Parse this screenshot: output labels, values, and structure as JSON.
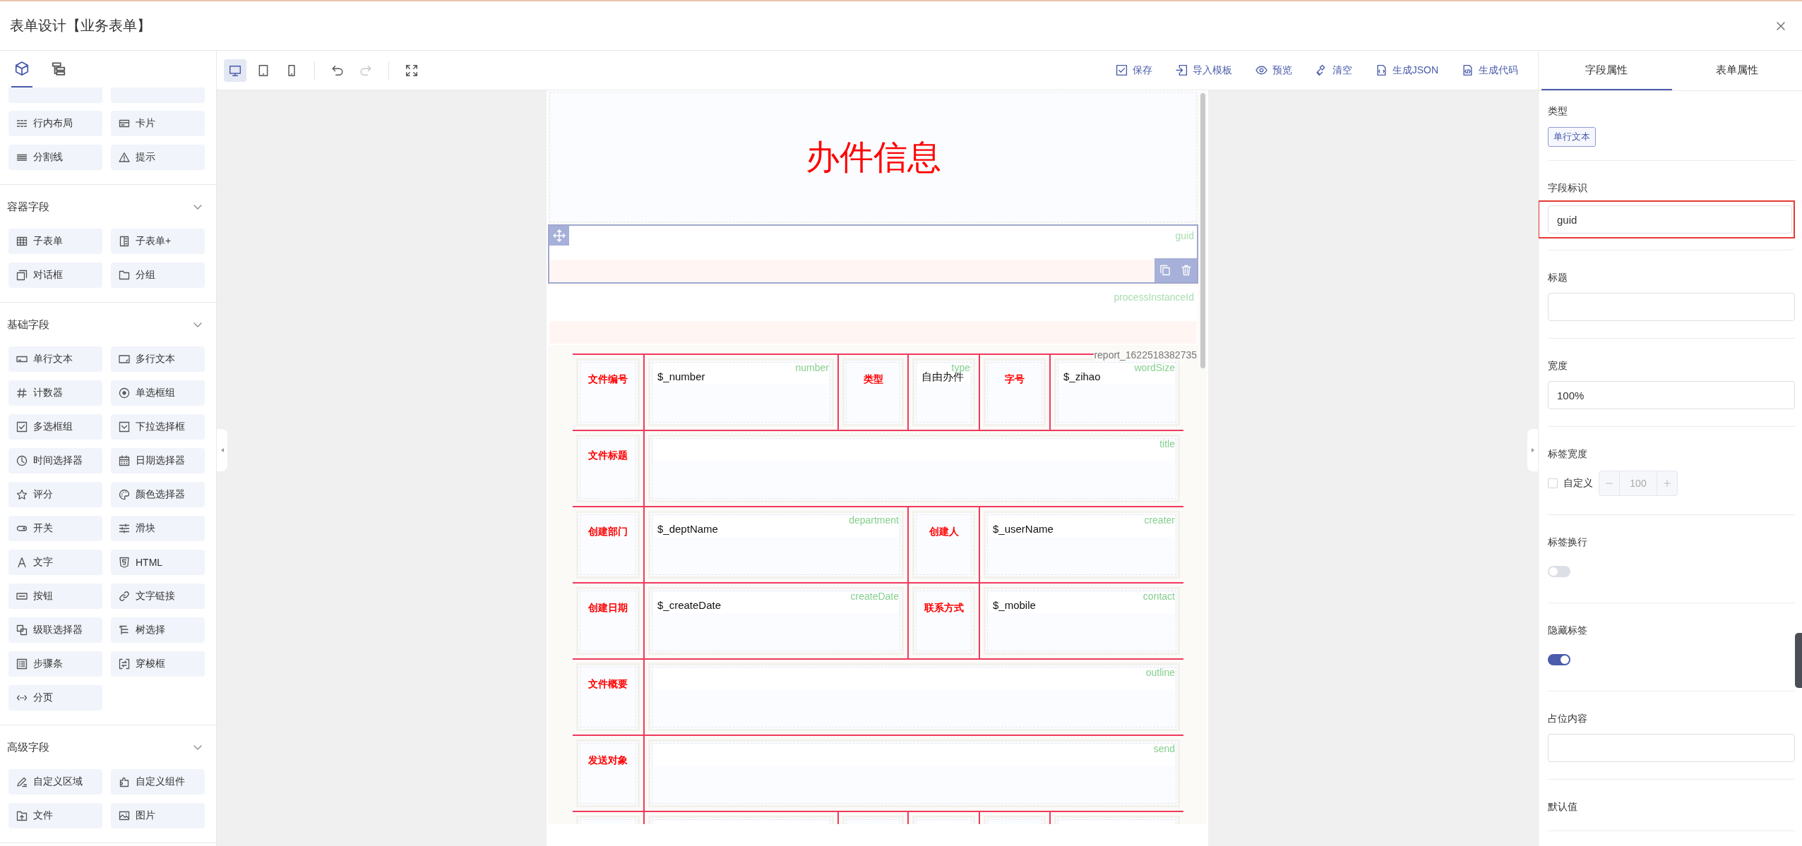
{
  "window": {
    "title": "表单设计【业务表单】"
  },
  "left_panel": {
    "tabs": [
      {
        "kind": "components",
        "selected": true
      },
      {
        "kind": "outline",
        "selected": false
      }
    ],
    "sections": [
      {
        "items": [
          {
            "label": "行内布局",
            "kind": "inline-layout"
          },
          {
            "label": "卡片",
            "kind": "card"
          },
          {
            "label": "分割线",
            "kind": "divider"
          },
          {
            "label": "提示",
            "kind": "alert"
          }
        ]
      },
      {
        "title": "容器字段",
        "expanded": true,
        "items": [
          {
            "label": "子表单",
            "kind": "table"
          },
          {
            "label": "子表单+",
            "kind": "subform-plus"
          },
          {
            "label": "对话框",
            "kind": "dialog"
          },
          {
            "label": "分组",
            "kind": "group"
          }
        ]
      },
      {
        "title": "基础字段",
        "expanded": true,
        "items": [
          {
            "label": "单行文本",
            "kind": "input"
          },
          {
            "label": "多行文本",
            "kind": "textarea"
          },
          {
            "label": "计数器",
            "kind": "number"
          },
          {
            "label": "单选框组",
            "kind": "radio"
          },
          {
            "label": "多选框组",
            "kind": "checkbox"
          },
          {
            "label": "下拉选择框",
            "kind": "select"
          },
          {
            "label": "时间选择器",
            "kind": "time"
          },
          {
            "label": "日期选择器",
            "kind": "date"
          },
          {
            "label": "评分",
            "kind": "rate"
          },
          {
            "label": "颜色选择器",
            "kind": "color"
          },
          {
            "label": "开关",
            "kind": "switch"
          },
          {
            "label": "滑块",
            "kind": "slider"
          },
          {
            "label": "文字",
            "kind": "text"
          },
          {
            "label": "HTML",
            "kind": "html"
          },
          {
            "label": "按钮",
            "kind": "button"
          },
          {
            "label": "文字链接",
            "kind": "link"
          },
          {
            "label": "级联选择器",
            "kind": "cascader"
          },
          {
            "label": "树选择",
            "kind": "tree"
          },
          {
            "label": "步骤条",
            "kind": "steps"
          },
          {
            "label": "穿梭框",
            "kind": "transfer"
          },
          {
            "label": "分页",
            "kind": "pagination"
          }
        ]
      },
      {
        "title": "高级字段",
        "expanded": true,
        "items": [
          {
            "label": "自定义区域",
            "kind": "custom-area"
          },
          {
            "label": "自定义组件",
            "kind": "custom-component"
          },
          {
            "label": "文件",
            "kind": "file"
          },
          {
            "label": "图片",
            "kind": "image"
          }
        ]
      }
    ]
  },
  "toolbar": {
    "devices": [
      {
        "kind": "desktop",
        "selected": true
      },
      {
        "kind": "tablet",
        "selected": false
      },
      {
        "kind": "phone",
        "selected": false
      }
    ],
    "history": [
      {
        "kind": "undo",
        "disabled": false
      },
      {
        "kind": "redo",
        "disabled": true
      }
    ],
    "actions": [
      {
        "label": "保存",
        "kind": "save"
      },
      {
        "label": "导入模板",
        "kind": "import"
      },
      {
        "label": "预览",
        "kind": "preview"
      },
      {
        "label": "清空",
        "kind": "clear"
      },
      {
        "label": "生成JSON",
        "kind": "json"
      },
      {
        "label": "生成代码",
        "kind": "code"
      }
    ]
  },
  "form": {
    "title": "办件信息",
    "widgets": [
      {
        "field": "guid",
        "selected": true
      },
      {
        "field": "processInstanceId",
        "selected": false
      }
    ],
    "report": {
      "name": "report_1622518382735",
      "rows": [
        {
          "cells": [
            {
              "kind": "label",
              "text": "文件编号"
            },
            {
              "kind": "field",
              "value": "$_number",
              "field": "number"
            },
            {
              "kind": "label",
              "text": "类型"
            },
            {
              "kind": "field",
              "value": "自由办件",
              "field": "type"
            },
            {
              "kind": "label",
              "text": "字号"
            },
            {
              "kind": "field",
              "value": "$_zihao",
              "field": "wordSize"
            }
          ]
        },
        {
          "cells": [
            {
              "kind": "label",
              "text": "文件标题"
            },
            {
              "kind": "field",
              "colspan": 5,
              "field": "title"
            }
          ]
        },
        {
          "cells": [
            {
              "kind": "label",
              "text": "创建部门"
            },
            {
              "kind": "field",
              "colspan": 2,
              "value": "$_deptName",
              "field": "department"
            },
            {
              "kind": "label",
              "text": "创建人"
            },
            {
              "kind": "field",
              "colspan": 2,
              "value": "$_userName",
              "field": "creater"
            }
          ]
        },
        {
          "cells": [
            {
              "kind": "label",
              "text": "创建日期"
            },
            {
              "kind": "field",
              "colspan": 2,
              "value": "$_createDate",
              "field": "createDate"
            },
            {
              "kind": "label",
              "text": "联系方式"
            },
            {
              "kind": "field",
              "colspan": 2,
              "value": "$_mobile",
              "field": "contact"
            }
          ]
        },
        {
          "cells": [
            {
              "kind": "label",
              "text": "文件概要"
            },
            {
              "kind": "field",
              "colspan": 5,
              "field": "outline"
            }
          ]
        },
        {
          "cells": [
            {
              "kind": "label",
              "text": "发送对象"
            },
            {
              "kind": "field",
              "colspan": 5,
              "field": "send"
            }
          ]
        },
        {
          "cells": [
            {
              "kind": "label"
            },
            {
              "kind": "field"
            },
            {
              "kind": "label"
            },
            {
              "kind": "field"
            },
            {
              "kind": "label"
            },
            {
              "kind": "field"
            }
          ]
        }
      ]
    }
  },
  "properties": {
    "tabs": [
      {
        "label": "字段属性",
        "selected": true
      },
      {
        "label": "表单属性",
        "selected": false
      }
    ],
    "items": [
      {
        "label": "类型",
        "kind": "tag",
        "value": "单行文本"
      },
      {
        "label": "字段标识",
        "kind": "input",
        "value": "guid",
        "highlighted": true
      },
      {
        "label": "标题",
        "kind": "input"
      },
      {
        "label": "宽度",
        "kind": "input",
        "value": "100%"
      },
      {
        "label": "标签宽度",
        "kind": "label-width",
        "checkbox": {
          "label": "自定义",
          "checked": false
        },
        "stepper": {
          "value": "100",
          "disabled": true
        }
      },
      {
        "label": "标签换行",
        "kind": "switch",
        "on": false
      },
      {
        "label": "隐藏标签",
        "kind": "switch",
        "on": true
      },
      {
        "label": "占位内容",
        "kind": "input"
      },
      {
        "label": "默认值"
      }
    ]
  }
}
